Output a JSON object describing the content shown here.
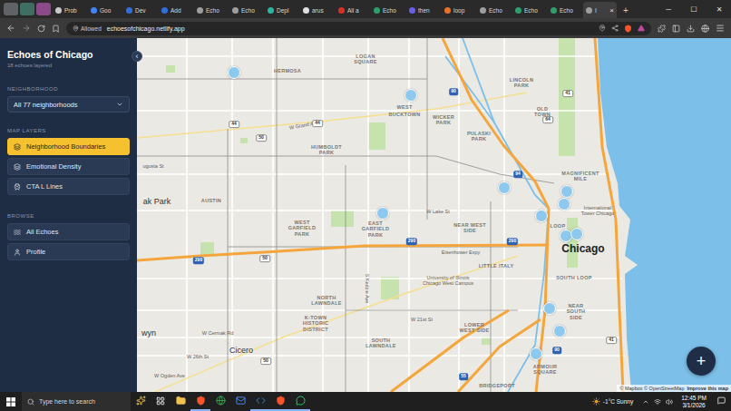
{
  "browser": {
    "pinned_tabs": [
      {
        "color": "#5f6368"
      },
      {
        "color": "#3f6f62"
      },
      {
        "color": "#8a4a8a"
      }
    ],
    "tabs": [
      {
        "label": "Prob",
        "selected": false,
        "color": "#c9c9c9"
      },
      {
        "label": "Goo",
        "selected": false,
        "color": "#4285f4"
      },
      {
        "label": "Dev",
        "selected": false,
        "color": "#2f6fdb"
      },
      {
        "label": "Add",
        "selected": false,
        "color": "#2f6fdb"
      },
      {
        "label": "Echo",
        "selected": false,
        "color": "#9e9e9e"
      },
      {
        "label": "Echo",
        "selected": false,
        "color": "#9e9e9e"
      },
      {
        "label": "Depl",
        "selected": false,
        "color": "#2bb5a0"
      },
      {
        "label": "arus",
        "selected": false,
        "color": "#e0e0e0"
      },
      {
        "label": "All a",
        "selected": false,
        "color": "#d93025"
      },
      {
        "label": "Echo",
        "selected": false,
        "color": "#2e9e6a"
      },
      {
        "label": "then",
        "selected": false,
        "color": "#6c5ce7"
      },
      {
        "label": "loop",
        "selected": false,
        "color": "#e8702a"
      },
      {
        "label": "Echo",
        "selected": false,
        "color": "#9e9e9e"
      },
      {
        "label": "Echo",
        "selected": false,
        "color": "#2e9e6a"
      },
      {
        "label": "Echo",
        "selected": false,
        "color": "#2e9e6a"
      },
      {
        "label": "I",
        "selected": true,
        "color": "#9e9e9e"
      }
    ],
    "close_tab": "×",
    "new_tab": "+",
    "window_controls": [
      "─",
      "☐",
      "✕"
    ],
    "permission": "Allowed",
    "url": "echoesofchicago.netlify.app"
  },
  "sidebar": {
    "title": "Echoes of Chicago",
    "subtitle": "18 echoes layered",
    "collapse": "‹",
    "neighborhood": {
      "heading": "NEIGHBORHOOD",
      "value": "All 77 neighborhoods"
    },
    "map_layers": {
      "heading": "MAP LAYERS",
      "items": [
        {
          "label": "Neighborhood Boundaries",
          "selected": true
        },
        {
          "label": "Emotional Density",
          "selected": false
        },
        {
          "label": "CTA L Lines",
          "selected": false
        }
      ]
    },
    "browse": {
      "heading": "BROWSE",
      "items": [
        {
          "label": "All Echoes",
          "selected": false
        },
        {
          "label": "Profile",
          "selected": false
        }
      ]
    }
  },
  "map": {
    "labels": [
      {
        "text": "HERMOSA",
        "kind": "area"
      },
      {
        "text": "LOGAN SQUARE",
        "kind": "area"
      },
      {
        "text": "LINCOLN PARK",
        "kind": "area"
      },
      {
        "text": "WEST",
        "kind": "area"
      },
      {
        "text": "BUCKTOWN",
        "kind": "area"
      },
      {
        "text": "WICKER PARK",
        "kind": "area"
      },
      {
        "text": "OLD TOWN",
        "kind": "area"
      },
      {
        "text": "PULASKI PARK",
        "kind": "area"
      },
      {
        "text": "HUMBOLDT PARK",
        "kind": "area"
      },
      {
        "text": "MAGNIFICENT MILE",
        "kind": "area"
      },
      {
        "text": "AUSTIN",
        "kind": "area"
      },
      {
        "text": "WEST GARFIELD PARK",
        "kind": "area"
      },
      {
        "text": "EAST GARFIELD PARK",
        "kind": "area"
      },
      {
        "text": "NEAR WEST SIDE",
        "kind": "area"
      },
      {
        "text": "LOOP",
        "kind": "area"
      },
      {
        "text": "LITTLE ITALY",
        "kind": "area"
      },
      {
        "text": "NORTH LAWNDALE",
        "kind": "area"
      },
      {
        "text": "K-TOWN HISTORIC DISTRICT",
        "kind": "area"
      },
      {
        "text": "SOUTH LAWNDALE",
        "kind": "area"
      },
      {
        "text": "LOWER WEST SIDE",
        "kind": "area"
      },
      {
        "text": "SOUTH LOOP",
        "kind": "area"
      },
      {
        "text": "NEAR SOUTH SIDE",
        "kind": "area"
      },
      {
        "text": "ARMOUR SQUARE",
        "kind": "area"
      },
      {
        "text": "BRIDGEPORT",
        "kind": "area"
      },
      {
        "text": "W Grand Ave",
        "kind": "street"
      },
      {
        "text": "ugusta St",
        "kind": "street"
      },
      {
        "text": "W Lake St",
        "kind": "street"
      },
      {
        "text": "Eisenhower Expy",
        "kind": "street"
      },
      {
        "text": "S Kedzie Ave",
        "kind": "street"
      },
      {
        "text": "W 21st St",
        "kind": "street"
      },
      {
        "text": "W Cermak Rd",
        "kind": "street"
      },
      {
        "text": "W 26th St",
        "kind": "street"
      },
      {
        "text": "W Ogden Ave",
        "kind": "street"
      },
      {
        "text": "ak Park",
        "kind": "city"
      },
      {
        "text": "Chicago",
        "kind": "capital"
      },
      {
        "text": "wyn",
        "kind": "city"
      },
      {
        "text": "Cicero",
        "kind": "city"
      },
      {
        "text": "International Tower Chicago",
        "kind": "poi"
      },
      {
        "text": "University of Illinois Chicago West Campus",
        "kind": "poi"
      },
      {
        "text": "44",
        "kind": "route"
      },
      {
        "text": "44",
        "kind": "route"
      },
      {
        "text": "50",
        "kind": "route"
      },
      {
        "text": "64",
        "kind": "route"
      },
      {
        "text": "41",
        "kind": "route"
      },
      {
        "text": "90",
        "kind": "interstate"
      },
      {
        "text": "290",
        "kind": "interstate"
      },
      {
        "text": "50",
        "kind": "route"
      },
      {
        "text": "290",
        "kind": "interstate"
      },
      {
        "text": "290",
        "kind": "interstate"
      },
      {
        "text": "94",
        "kind": "interstate"
      },
      {
        "text": "55",
        "kind": "interstate"
      },
      {
        "text": "41",
        "kind": "route"
      },
      {
        "text": "50",
        "kind": "route"
      },
      {
        "text": "90",
        "kind": "interstate"
      }
    ],
    "add_button": "+",
    "attribution": "© Mapbox © OpenStreetMap",
    "improve": "Improve this map"
  },
  "taskbar": {
    "search": "Type here to search",
    "weather": "-1°C Sunny",
    "time": "12:45 PM",
    "date": "3/1/2026"
  }
}
